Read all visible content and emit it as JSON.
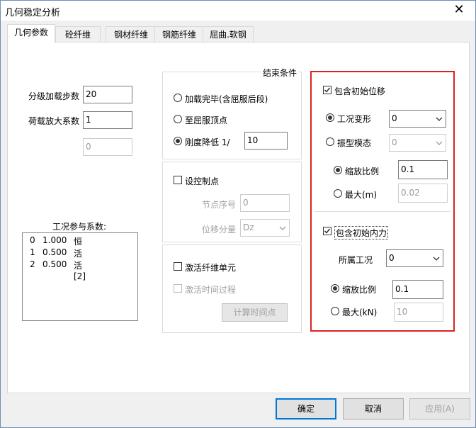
{
  "window": {
    "title": "几何稳定分析",
    "close_glyph": "✕"
  },
  "tabs": [
    {
      "label": "几何参数",
      "active": true
    },
    {
      "label": "砼纤维"
    },
    {
      "label": "钢材纤维"
    },
    {
      "label": "钢筋纤维"
    },
    {
      "label": "屈曲.软钢"
    }
  ],
  "left": {
    "steps_label": "分级加载步数",
    "steps_value": "20",
    "amplify_label": "荷载放大系数",
    "amplify_value": "1",
    "extra_value": "0",
    "cases_title": "工况参与系数:",
    "cases": [
      {
        "idx": "0",
        "factor": "1.000",
        "name": "恒"
      },
      {
        "idx": "1",
        "factor": "0.500",
        "name": "活"
      },
      {
        "idx": "2",
        "factor": "0.500",
        "name": "活[2]"
      }
    ]
  },
  "middle": {
    "end_title": "结束条件",
    "opt_load_done": "加载完毕(含屈服后段)",
    "opt_yield_top": "至屈服顶点",
    "opt_stiff": "刚度降低 1/",
    "stiff_value": "10",
    "control_label": "设控制点",
    "node_label": "节点序号",
    "node_value": "0",
    "disp_label": "位移分量",
    "disp_value": "Dz",
    "activate_label": "激活纤维单元",
    "activate_time_label": "激活时间过程",
    "calc_time_btn": "计算时间点"
  },
  "right": {
    "init_disp_label": "包含初始位移",
    "case_deform_label": "工况变形",
    "case_deform_value": "0",
    "mode_label": "振型模态",
    "mode_value": "0",
    "scale_label": "缩放比例",
    "scale_value": "0.1",
    "max_m_label": "最大(m)",
    "max_m_value": "0.02",
    "init_force_label": "包含初始内力",
    "belong_case_label": "所属工况",
    "belong_case_value": "0",
    "scale2_label": "缩放比例",
    "scale2_value": "0.1",
    "max_kn_label": "最大(kN)",
    "max_kn_value": "10"
  },
  "footer": {
    "ok": "确定",
    "cancel": "取消",
    "apply": "应用(A)"
  },
  "colors": {
    "highlight_border": "#e02020",
    "default_btn": "#0078d7"
  }
}
